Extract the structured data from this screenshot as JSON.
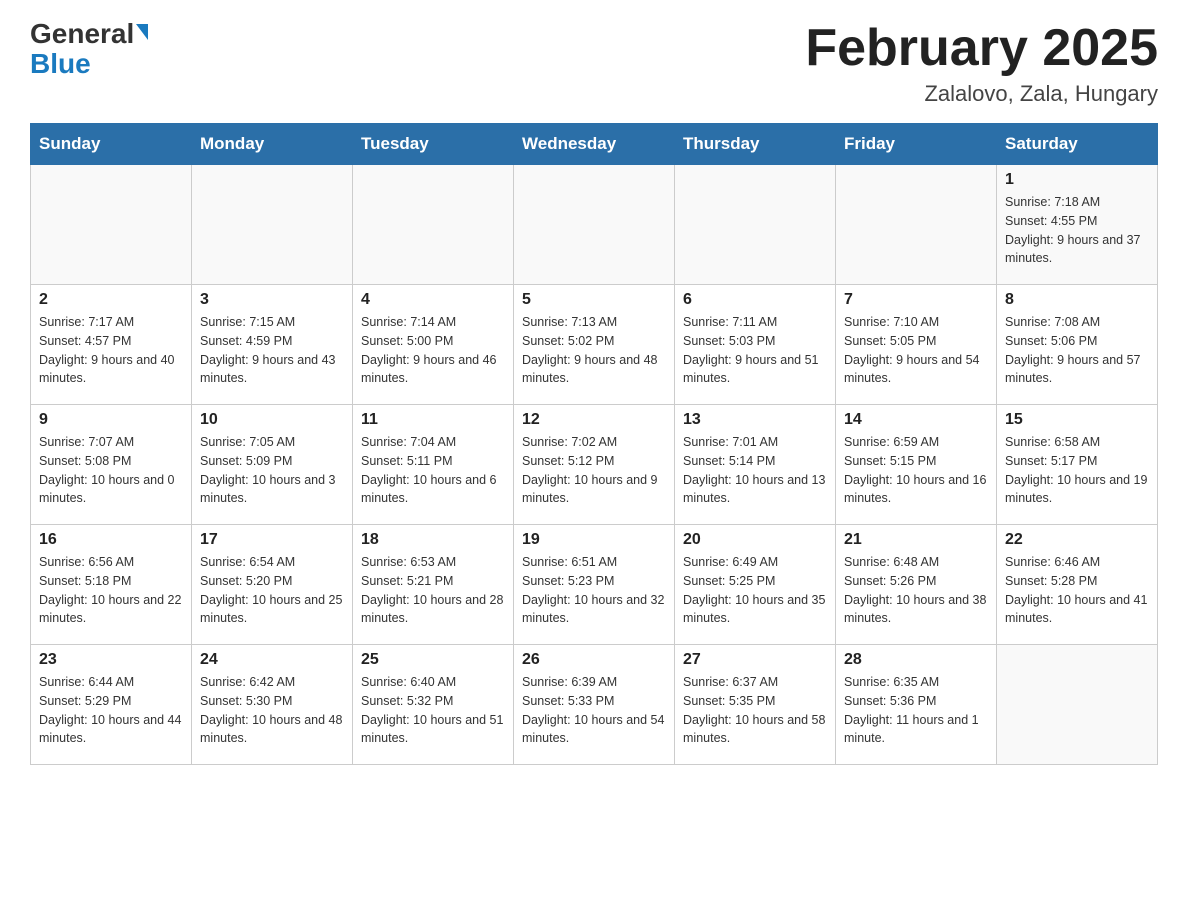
{
  "header": {
    "logo_general": "General",
    "logo_blue": "Blue",
    "month_title": "February 2025",
    "location": "Zalalovo, Zala, Hungary"
  },
  "days_of_week": [
    "Sunday",
    "Monday",
    "Tuesday",
    "Wednesday",
    "Thursday",
    "Friday",
    "Saturday"
  ],
  "weeks": [
    [
      {
        "day": "",
        "sunrise": "",
        "sunset": "",
        "daylight": ""
      },
      {
        "day": "",
        "sunrise": "",
        "sunset": "",
        "daylight": ""
      },
      {
        "day": "",
        "sunrise": "",
        "sunset": "",
        "daylight": ""
      },
      {
        "day": "",
        "sunrise": "",
        "sunset": "",
        "daylight": ""
      },
      {
        "day": "",
        "sunrise": "",
        "sunset": "",
        "daylight": ""
      },
      {
        "day": "",
        "sunrise": "",
        "sunset": "",
        "daylight": ""
      },
      {
        "day": "1",
        "sunrise": "Sunrise: 7:18 AM",
        "sunset": "Sunset: 4:55 PM",
        "daylight": "Daylight: 9 hours and 37 minutes."
      }
    ],
    [
      {
        "day": "2",
        "sunrise": "Sunrise: 7:17 AM",
        "sunset": "Sunset: 4:57 PM",
        "daylight": "Daylight: 9 hours and 40 minutes."
      },
      {
        "day": "3",
        "sunrise": "Sunrise: 7:15 AM",
        "sunset": "Sunset: 4:59 PM",
        "daylight": "Daylight: 9 hours and 43 minutes."
      },
      {
        "day": "4",
        "sunrise": "Sunrise: 7:14 AM",
        "sunset": "Sunset: 5:00 PM",
        "daylight": "Daylight: 9 hours and 46 minutes."
      },
      {
        "day": "5",
        "sunrise": "Sunrise: 7:13 AM",
        "sunset": "Sunset: 5:02 PM",
        "daylight": "Daylight: 9 hours and 48 minutes."
      },
      {
        "day": "6",
        "sunrise": "Sunrise: 7:11 AM",
        "sunset": "Sunset: 5:03 PM",
        "daylight": "Daylight: 9 hours and 51 minutes."
      },
      {
        "day": "7",
        "sunrise": "Sunrise: 7:10 AM",
        "sunset": "Sunset: 5:05 PM",
        "daylight": "Daylight: 9 hours and 54 minutes."
      },
      {
        "day": "8",
        "sunrise": "Sunrise: 7:08 AM",
        "sunset": "Sunset: 5:06 PM",
        "daylight": "Daylight: 9 hours and 57 minutes."
      }
    ],
    [
      {
        "day": "9",
        "sunrise": "Sunrise: 7:07 AM",
        "sunset": "Sunset: 5:08 PM",
        "daylight": "Daylight: 10 hours and 0 minutes."
      },
      {
        "day": "10",
        "sunrise": "Sunrise: 7:05 AM",
        "sunset": "Sunset: 5:09 PM",
        "daylight": "Daylight: 10 hours and 3 minutes."
      },
      {
        "day": "11",
        "sunrise": "Sunrise: 7:04 AM",
        "sunset": "Sunset: 5:11 PM",
        "daylight": "Daylight: 10 hours and 6 minutes."
      },
      {
        "day": "12",
        "sunrise": "Sunrise: 7:02 AM",
        "sunset": "Sunset: 5:12 PM",
        "daylight": "Daylight: 10 hours and 9 minutes."
      },
      {
        "day": "13",
        "sunrise": "Sunrise: 7:01 AM",
        "sunset": "Sunset: 5:14 PM",
        "daylight": "Daylight: 10 hours and 13 minutes."
      },
      {
        "day": "14",
        "sunrise": "Sunrise: 6:59 AM",
        "sunset": "Sunset: 5:15 PM",
        "daylight": "Daylight: 10 hours and 16 minutes."
      },
      {
        "day": "15",
        "sunrise": "Sunrise: 6:58 AM",
        "sunset": "Sunset: 5:17 PM",
        "daylight": "Daylight: 10 hours and 19 minutes."
      }
    ],
    [
      {
        "day": "16",
        "sunrise": "Sunrise: 6:56 AM",
        "sunset": "Sunset: 5:18 PM",
        "daylight": "Daylight: 10 hours and 22 minutes."
      },
      {
        "day": "17",
        "sunrise": "Sunrise: 6:54 AM",
        "sunset": "Sunset: 5:20 PM",
        "daylight": "Daylight: 10 hours and 25 minutes."
      },
      {
        "day": "18",
        "sunrise": "Sunrise: 6:53 AM",
        "sunset": "Sunset: 5:21 PM",
        "daylight": "Daylight: 10 hours and 28 minutes."
      },
      {
        "day": "19",
        "sunrise": "Sunrise: 6:51 AM",
        "sunset": "Sunset: 5:23 PM",
        "daylight": "Daylight: 10 hours and 32 minutes."
      },
      {
        "day": "20",
        "sunrise": "Sunrise: 6:49 AM",
        "sunset": "Sunset: 5:25 PM",
        "daylight": "Daylight: 10 hours and 35 minutes."
      },
      {
        "day": "21",
        "sunrise": "Sunrise: 6:48 AM",
        "sunset": "Sunset: 5:26 PM",
        "daylight": "Daylight: 10 hours and 38 minutes."
      },
      {
        "day": "22",
        "sunrise": "Sunrise: 6:46 AM",
        "sunset": "Sunset: 5:28 PM",
        "daylight": "Daylight: 10 hours and 41 minutes."
      }
    ],
    [
      {
        "day": "23",
        "sunrise": "Sunrise: 6:44 AM",
        "sunset": "Sunset: 5:29 PM",
        "daylight": "Daylight: 10 hours and 44 minutes."
      },
      {
        "day": "24",
        "sunrise": "Sunrise: 6:42 AM",
        "sunset": "Sunset: 5:30 PM",
        "daylight": "Daylight: 10 hours and 48 minutes."
      },
      {
        "day": "25",
        "sunrise": "Sunrise: 6:40 AM",
        "sunset": "Sunset: 5:32 PM",
        "daylight": "Daylight: 10 hours and 51 minutes."
      },
      {
        "day": "26",
        "sunrise": "Sunrise: 6:39 AM",
        "sunset": "Sunset: 5:33 PM",
        "daylight": "Daylight: 10 hours and 54 minutes."
      },
      {
        "day": "27",
        "sunrise": "Sunrise: 6:37 AM",
        "sunset": "Sunset: 5:35 PM",
        "daylight": "Daylight: 10 hours and 58 minutes."
      },
      {
        "day": "28",
        "sunrise": "Sunrise: 6:35 AM",
        "sunset": "Sunset: 5:36 PM",
        "daylight": "Daylight: 11 hours and 1 minute."
      },
      {
        "day": "",
        "sunrise": "",
        "sunset": "",
        "daylight": ""
      }
    ]
  ]
}
